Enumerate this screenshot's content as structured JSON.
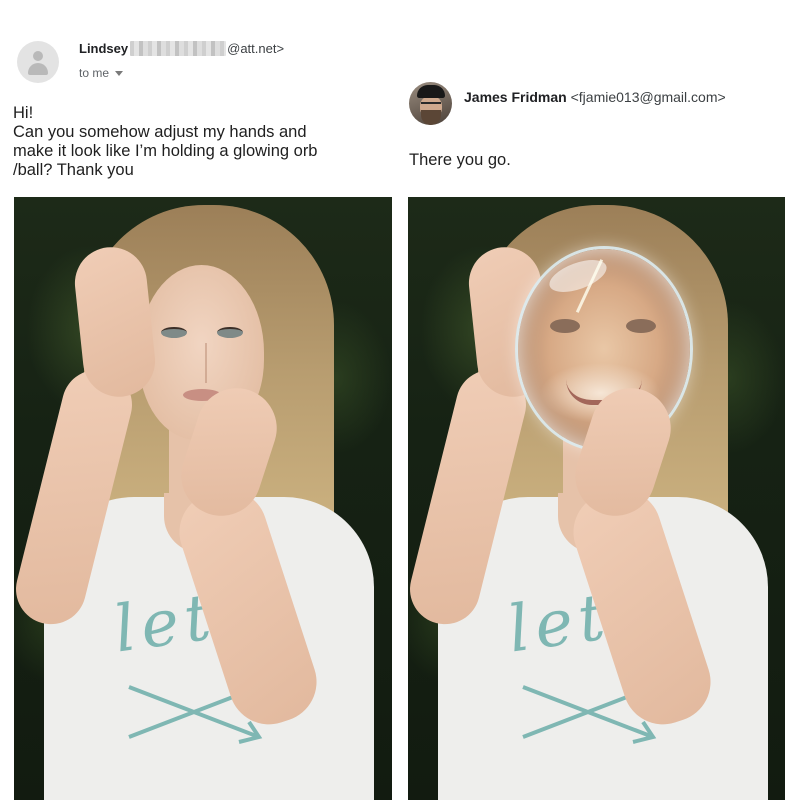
{
  "request_email": {
    "sender_name": "Lindsey",
    "sender_domain": "@att.net>",
    "recipient": "to me",
    "body_lines": [
      "Hi!",
      "Can you somehow adjust my hands and",
      "make it look like I’m holding a glowing orb",
      "/ball? Thank you"
    ]
  },
  "reply_email": {
    "sender_name": "James Fridman",
    "sender_email": "<fjamie013@gmail.com>",
    "body": "There you go."
  },
  "icons": {
    "default_avatar": "person-placeholder-icon",
    "recipient_dropdown": "chevron-down-icon"
  },
  "colors": {
    "background": "#ffffff",
    "photo_background": "#18231a",
    "shirt_print": "#7fb7b3"
  }
}
